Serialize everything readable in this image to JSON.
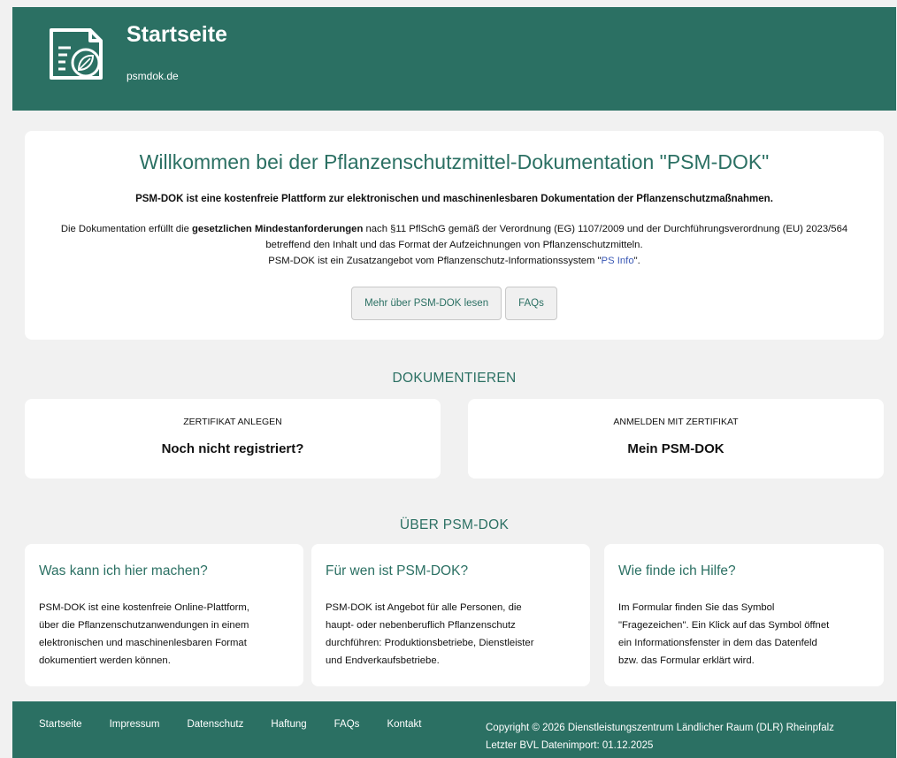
{
  "header": {
    "title": "Startseite",
    "subtitle": "psmdok.de"
  },
  "welcome": {
    "title": "Willkommen bei der Pflanzenschutzmittel-Dokumentation \"PSM-DOK\"",
    "intro": "PSM-DOK ist eine kostenfreie Plattform zur elektronischen und maschinenlesbaren Dokumentation der Pflanzenschutzmaßnahmen.",
    "line1_before": "Die Dokumentation erfüllt die ",
    "line1_bold": "gesetzlichen Mindestanforderungen",
    "line1_after": " nach §11 PflSchG gemäß der Verordnung (EG) 1107/2009 und der Durchführungsverordnung (EU) 2023/564 betreffend den Inhalt und das Format der Aufzeichnungen von Pflanzenschutzmitteln.",
    "line2_before": "PSM-DOK ist ein Zusatzangebot vom Pflanzenschutz-Informationssystem \"",
    "line2_link": "PS Info",
    "line2_after": "\".",
    "btn_more": "Mehr über PSM-DOK lesen",
    "btn_faqs": "FAQs"
  },
  "dokumentieren": {
    "section_title": "DOKUMENTIEREN",
    "left": {
      "label": "ZERTIFIKAT ANLEGEN",
      "value": "Noch nicht registriert?"
    },
    "right": {
      "label": "ANMELDEN MIT ZERTIFIKAT",
      "value": "Mein PSM-DOK"
    }
  },
  "ueber": {
    "section_title": "ÜBER PSM-DOK",
    "cards": [
      {
        "title": "Was kann ich hier machen?",
        "lines": [
          "PSM-DOK ist eine kostenfreie Online-Plattform,",
          "über die Pflanzenschutzanwendungen in einem",
          "elektronischen und maschinenlesbaren Format",
          "dokumentiert werden können."
        ]
      },
      {
        "title": "Für wen ist PSM-DOK?",
        "lines": [
          "PSM-DOK ist Angebot für alle Personen, die",
          "haupt- oder nebenberuflich Pflanzenschutz",
          "durchführen: Produktionsbetriebe, Dienstleister",
          "und Endverkaufsbetriebe."
        ]
      },
      {
        "title": "Wie finde ich Hilfe?",
        "lines": [
          "Im Formular finden Sie das Symbol",
          "\"Fragezeichen\". Ein Klick auf das Symbol öffnet",
          "ein Informationsfenster in dem das Datenfeld",
          "bzw. das Formular erklärt wird."
        ]
      }
    ]
  },
  "footer": {
    "nav": [
      "Startseite",
      "Impressum",
      "Datenschutz",
      "Haftung",
      "FAQs",
      "Kontakt"
    ],
    "copyright": "Copyright © 2026 Dienstleistungszentrum Ländlicher Raum (DLR) Rheinpfalz",
    "import": "Letzter BVL Datenimport: 01.12.2025"
  },
  "colors": {
    "brand": "#2b7063",
    "link": "#3a58b5",
    "background": "#f1f1f1"
  },
  "icons": {
    "logo": "document-leaf-icon"
  }
}
